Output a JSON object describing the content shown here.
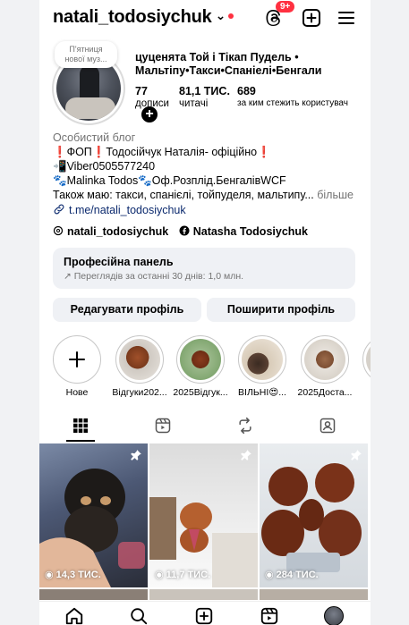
{
  "header": {
    "username": "natali_todosiychuk",
    "threads_badge": "9+"
  },
  "profile": {
    "note": "П'ятниця нової муз...",
    "display_name": "цуценята  Той і Тікап Пудель • Мальтіпу•Такси•Спаніелі•Бенгали",
    "stats": [
      {
        "value": "77",
        "label": "дописи"
      },
      {
        "value": "81,1 ТИС.",
        "label": "читачі"
      },
      {
        "value": "689",
        "label": "за ким стежить користувач"
      }
    ],
    "category": "Особистий блог",
    "bio_lines": [
      "❗️ФОП❗️Тодосійчук Наталія- офіційно❗️",
      "📲Viber0505577240",
      "🐾Malinka Todos🐾Оф.Розплід.БенгалівWCF",
      "Також маю: такси, спанієлі, тойпуделя, мальтипу..."
    ],
    "bio_more": "більше",
    "link": "t.me/natali_todosiychuk",
    "threads_handle": "natali_todosiychuk",
    "facebook_name": "Natasha Todosiychuk"
  },
  "dashboard": {
    "title": "Професійна панель",
    "subtitle": "Переглядів за останні 30 днів: 1,0 млн."
  },
  "buttons": {
    "edit": "Редагувати профіль",
    "share": "Поширити профіль"
  },
  "highlights": [
    {
      "label": "Нове"
    },
    {
      "label": "Відгуки202..."
    },
    {
      "label": "2025Відгук..."
    },
    {
      "label": "ВІЛЬНІ😍..."
    },
    {
      "label": "2025Доста..."
    }
  ],
  "posts": [
    {
      "views": "14,3 ТИС.",
      "pinned": true
    },
    {
      "views": "11,7 ТИС.",
      "pinned": true
    },
    {
      "views": "284 ТИС.",
      "pinned": true
    }
  ],
  "icons": {
    "threads": "threads-icon",
    "new_post": "plus-square-icon",
    "menu": "hamburger-icon",
    "grid": "grid-icon",
    "reels": "reels-icon",
    "reposts": "repost-icon",
    "tagged": "tagged-icon",
    "home": "home-icon",
    "search": "search-icon",
    "create": "create-icon",
    "reels_nav": "reels-nav-icon",
    "profile": "profile-avatar-icon"
  },
  "colors": {
    "badge": "#ff3040",
    "link": "#0c2a6e",
    "button_bg": "#eff1f5",
    "muted": "#737373"
  }
}
